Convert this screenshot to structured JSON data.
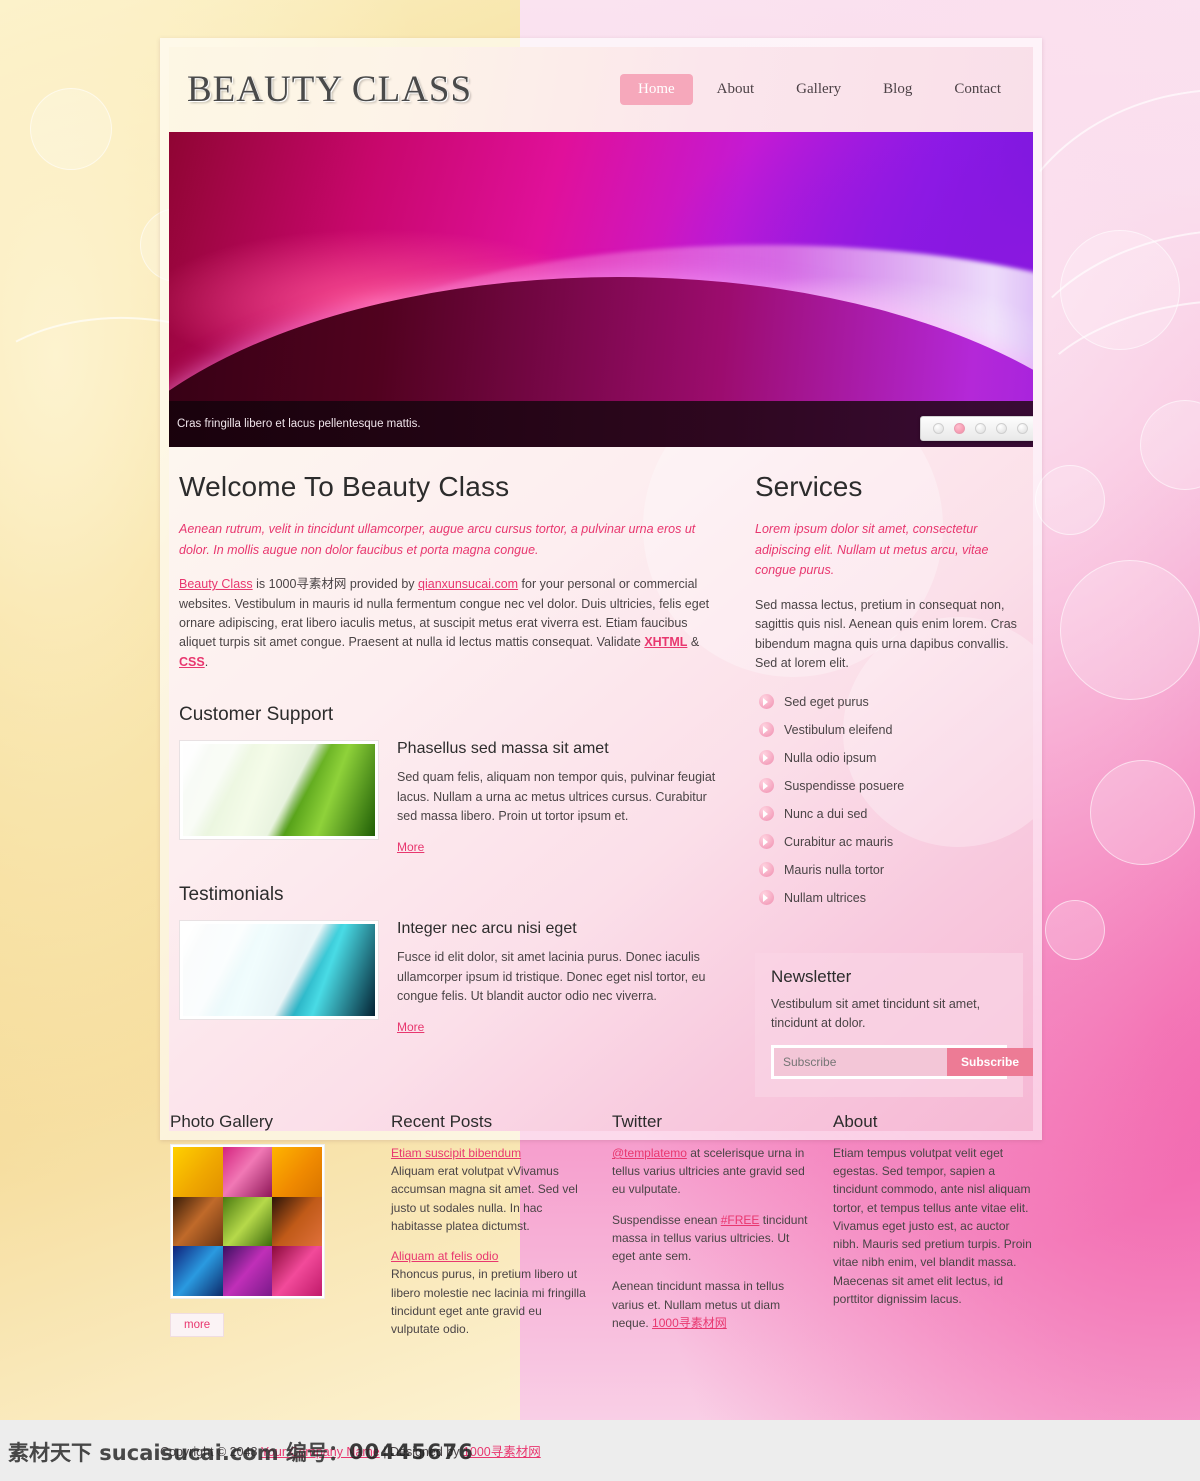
{
  "site": {
    "logo": "BEAUTY CLASS",
    "nav": [
      {
        "label": "Home",
        "active": true
      },
      {
        "label": "About",
        "active": false
      },
      {
        "label": "Gallery",
        "active": false
      },
      {
        "label": "Blog",
        "active": false
      },
      {
        "label": "Contact",
        "active": false
      }
    ]
  },
  "banner": {
    "caption": "Cras fringilla libero et lacus pellentesque mattis.",
    "dots": 5,
    "active_dot": 2
  },
  "welcome": {
    "heading": "Welcome To Beauty Class",
    "intro": "Aenean rutrum, velit in tincidunt ullamcorper, augue arcu cursus tortor, a pulvinar urna eros ut dolor. In mollis augue non dolor faucibus et porta magna congue.",
    "link_brand": "Beauty Class",
    "text_1": " is 1000寻素材网 provided by ",
    "link_provider": "qianxunsucai.com",
    "text_2": " for your personal or commercial websites. Vestibulum in mauris id nulla fermentum congue nec vel dolor. Duis ultricies, felis eget ornare adipiscing, erat libero iaculis metus, at suscipit metus erat viverra est. Etiam faucibus aliquet turpis sit amet congue. Praesent at nulla id lectus mattis consequat. Validate ",
    "link_xhtml": "XHTML",
    "text_3": " & ",
    "link_css": "CSS",
    "text_4": "."
  },
  "customer_support": {
    "heading": "Customer Support",
    "item_title": "Phasellus sed massa sit amet",
    "item_text": "Sed quam felis, aliquam non tempor quis, pulvinar feugiat lacus. Nullam a urna ac metus ultrices cursus. Curabitur sed massa libero. Proin ut tortor ipsum et.",
    "more": "More"
  },
  "testimonials": {
    "heading": "Testimonials",
    "item_title": "Integer nec arcu nisi eget",
    "item_text": "Fusce id elit dolor, sit amet lacinia purus. Donec iaculis ullamcorper ipsum id tristique. Donec eget nisl tortor, eu congue felis. Ut blandit auctor odio nec viverra.",
    "more": "More"
  },
  "services": {
    "heading": "Services",
    "intro": "Lorem ipsum dolor sit amet, consectetur adipiscing elit. Nullam ut metus arcu, vitae congue purus.",
    "body": "Sed massa lectus, pretium in consequat non, sagittis quis nisl. Aenean quis enim lorem. Cras bibendum magna quis urna dapibus convallis. Sed at lorem elit.",
    "items": [
      "Sed eget purus",
      "Vestibulum eleifend",
      "Nulla odio ipsum",
      "Suspendisse posuere",
      "Nunc a dui sed",
      "Curabitur ac mauris",
      "Mauris nulla tortor",
      "Nullam ultrices"
    ]
  },
  "newsletter": {
    "heading": "Newsletter",
    "text": "Vestibulum sit amet tincidunt sit amet, tincidunt at dolor.",
    "input_placeholder": "Subscribe",
    "button": "Subscribe"
  },
  "footer": {
    "gallery": {
      "heading": "Photo Gallery",
      "more": "more",
      "cells": [
        "#f5c200",
        "#d4247f",
        "#f0a000",
        "#b2591a",
        "#8fbe2a",
        "#a54c18",
        "#1d4fb8",
        "#a42fb0",
        "#e0277f"
      ]
    },
    "recent_posts": {
      "heading": "Recent Posts",
      "posts": [
        {
          "title": "Etiam suscipit bibendum",
          "text": "Aliquam erat volutpat vVivamus accumsan magna sit amet. Sed vel justo ut sodales nulla. In hac habitasse platea dictumst."
        },
        {
          "title": "Aliquam at felis odio",
          "text": "Rhoncus purus, in pretium libero ut libero molestie nec lacinia mi fringilla tincidunt eget ante gravid eu vulputate odio."
        }
      ]
    },
    "twitter": {
      "heading": "Twitter",
      "handle": "@templatemo",
      "p1_rest": " at scelerisque urna in tellus varius ultricies ante gravid sed eu vulputate.",
      "p2_pre": "Suspendisse enean ",
      "p2_link": "#FREE",
      "p2_rest": " tincidunt massa in tellus varius ultricies. Ut eget ante sem.",
      "p3_pre": "Aenean tincidunt massa in tellus varius et. Nullam metus ut diam neque. ",
      "p3_link": "1000寻素材网"
    },
    "about": {
      "heading": "About",
      "text": "Etiam tempus volutpat velit eget egestas. Sed tempor, sapien a tincidunt commodo, ante nisl aliquam tortor, et tempus tellus ante vitae elit. Vivamus eget justo est, ac auctor nibh. Mauris sed pretium turpis. Proin vitae nibh enim, vel blandit massa. Maecenas sit amet elit lectus, id porttitor dignissim lacus."
    }
  },
  "bottom_bar": {
    "copyright": "Copyright © 2048 ",
    "company_link": "Your Company Name",
    "divider": " | Designed by ",
    "designer_link": "1000寻素材网"
  },
  "watermark": {
    "text": "素材天下 sucaisucai.com  编号：",
    "number": "00445676"
  },
  "colors": {
    "accent_pink": "#e8376f",
    "nav_active": "#f6a8bb",
    "subscribe_btn": "#ed7b95"
  }
}
